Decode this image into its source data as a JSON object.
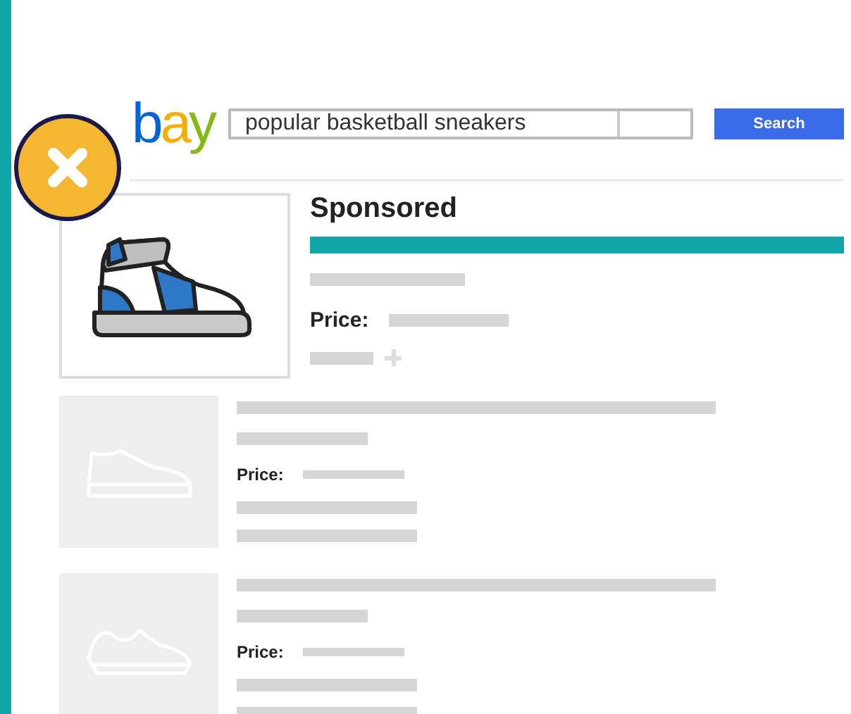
{
  "header": {
    "logo": "bay",
    "search": {
      "value": "popular basketball sneakers"
    },
    "search_button": "Search"
  },
  "sponsored": {
    "label": "Sponsored",
    "price_label": "Price:"
  },
  "listings": [
    {
      "price_label": "Price:",
      "kind": "shoe"
    },
    {
      "price_label": "Price:",
      "kind": "runner"
    }
  ]
}
